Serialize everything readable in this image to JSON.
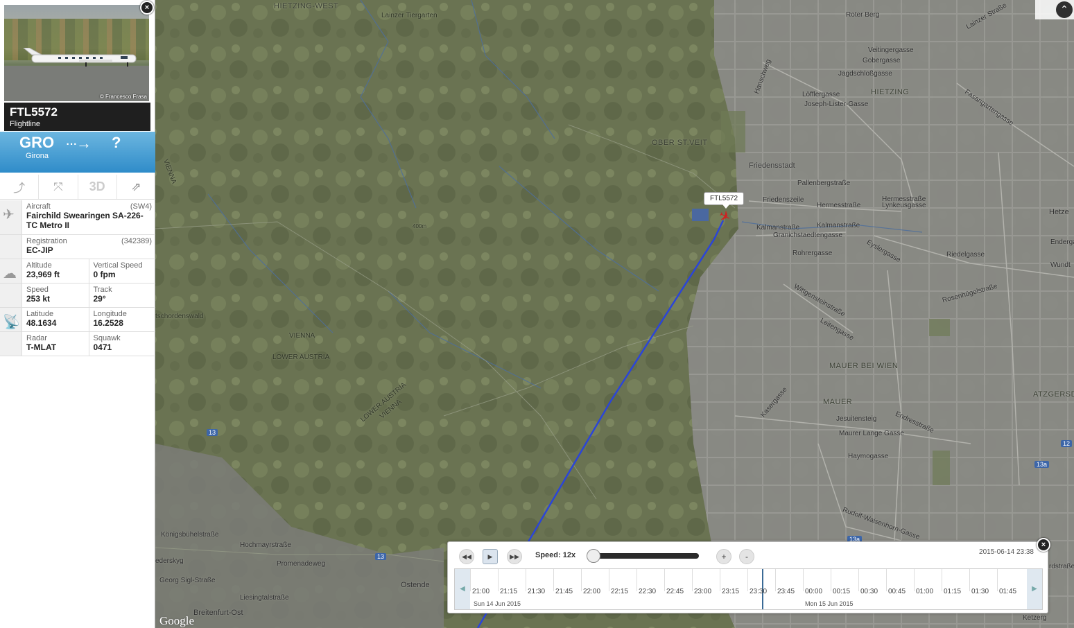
{
  "aircraft_photo": {
    "credit": "© Francesco Frasa",
    "close_label": "×"
  },
  "flight": {
    "callsign": "FTL5572",
    "airline": "Flightline",
    "origin_code": "GRO",
    "origin_name": "Girona",
    "arrow": "···→",
    "destination_code": "?"
  },
  "toolbar": {
    "route_icon": "route-icon",
    "zoom_icon": "fit-zoom-icon",
    "view3d_label": "3D",
    "share_icon": "share-icon"
  },
  "details": {
    "aircraft_label": "Aircraft",
    "aircraft_code": "(SW4)",
    "aircraft_value": "Fairchild Swearingen SA-226-TC Metro II",
    "registration_label": "Registration",
    "registration_code": "(342389)",
    "registration_value": "EC-JIP",
    "altitude_label": "Altitude",
    "altitude_value": "23,969 ft",
    "vspeed_label": "Vertical Speed",
    "vspeed_value": "0 fpm",
    "speed_label": "Speed",
    "speed_value": "253 kt",
    "track_label": "Track",
    "track_value": "29°",
    "latitude_label": "Latitude",
    "latitude_value": "48.1634",
    "longitude_label": "Longitude",
    "longitude_value": "16.2528",
    "radar_label": "Radar",
    "radar_value": "T-MLAT",
    "squawk_label": "Squawk",
    "squawk_value": "0471"
  },
  "map": {
    "flight_tag": "FTL5572",
    "google": "Google",
    "labels": {
      "hietzing_west": "HIETZING-WEST",
      "lainzer_tiergarten": "Lainzer Tiergarten",
      "ober_st_veit": "OBER ST.VEIT",
      "friedensstadt": "Friedensstadt",
      "hietzing": "HIETZING",
      "mauer_bei_wien": "MAUER BEI WIEN",
      "mauer": "MAUER",
      "vienna1": "VIENNA",
      "lower_austria1": "LOWER AUSTRIA",
      "lower_austria2": "LOWER AUSTRIA",
      "vienna2": "VIENNA",
      "vienna3": "VIENNA",
      "schordenswald": "tschordenswald",
      "breitenfurt_ost": "Breitenfurt-Ost",
      "ostende": "Ostende",
      "konigsbuhel": "Königsbühelstraße",
      "hochmayr": "Hochmayrstraße",
      "promenadeweg": "Promenadeweg",
      "georg_sigl": "Georg Sigl-Straße",
      "liesing": "Liesingtalstraße",
      "roter_berg": "Roter Berg",
      "lainzer_strasse": "Lainzer Straße",
      "veitingergasse": "Veitingergasse",
      "gobergasse": "Gobergasse",
      "jagdschloss": "Jagdschloßgasse",
      "loffler": "Löfflergasse",
      "joseph_lister": "Joseph-Lister-Gasse",
      "hanschweg": "Hanschweg",
      "pallenberg": "Pallenbergstraße",
      "friedenszeile": "Friedenszeile",
      "hermesstrasse": "Hermesstraße",
      "hermessstrasse2": "Hermesstraße",
      "lynkeus": "Lynkeusgasse",
      "kalman1": "Kalmanstraße",
      "kalman2": "Kalmanstraße",
      "granichstaedten": "Granichstaedtengasse",
      "rohrergasse": "Rohrergasse",
      "eyslergasse": "Eyslergasse",
      "riedelgasse": "Riedelgasse",
      "wittgenstein": "Wittgensteinstraße",
      "leitengasse": "Leitengasse",
      "rosenhugel": "Rosenhügelstraße",
      "jesuitensteig": "Jesuitensteig",
      "endresstrasse": "Endresstraße",
      "maurer_lange": "Maurer Lange Gasse",
      "haymogasse": "Haymogasse",
      "kasernegasse": "Kasergasse",
      "rudolf_waisenhorn": "Rudolf-Waisenhorn-Gasse",
      "fasangarten": "Fasangartengasse",
      "atzgersdorf": "ATZGERSDO",
      "hetz": "Hetze",
      "wundt": "Wundt",
      "ketzerg": "Ketzerg",
      "rdstrasse": "rdstraße",
      "edersky": "ederskyg",
      "ender": "Enderga",
      "road13a": "13",
      "road13b": "13",
      "road12": "12",
      "road13c": "13a",
      "road13d": "13a",
      "elev400": "400m"
    }
  },
  "playback": {
    "speed_label": "Speed: 12x",
    "timestamp": "2015-06-14 23:38",
    "plus": "+",
    "minus": "-",
    "ticks": [
      "21:00",
      "21:15",
      "21:30",
      "21:45",
      "22:00",
      "22:15",
      "22:30",
      "22:45",
      "23:00",
      "23:15",
      "23:30",
      "23:45",
      "00:00",
      "00:15",
      "00:30",
      "00:45",
      "01:00",
      "01:15",
      "01:30",
      "01:45"
    ],
    "date1": "Sun 14 Jun 2015",
    "date2": "Mon 15 Jun 2015",
    "close_label": "×"
  }
}
